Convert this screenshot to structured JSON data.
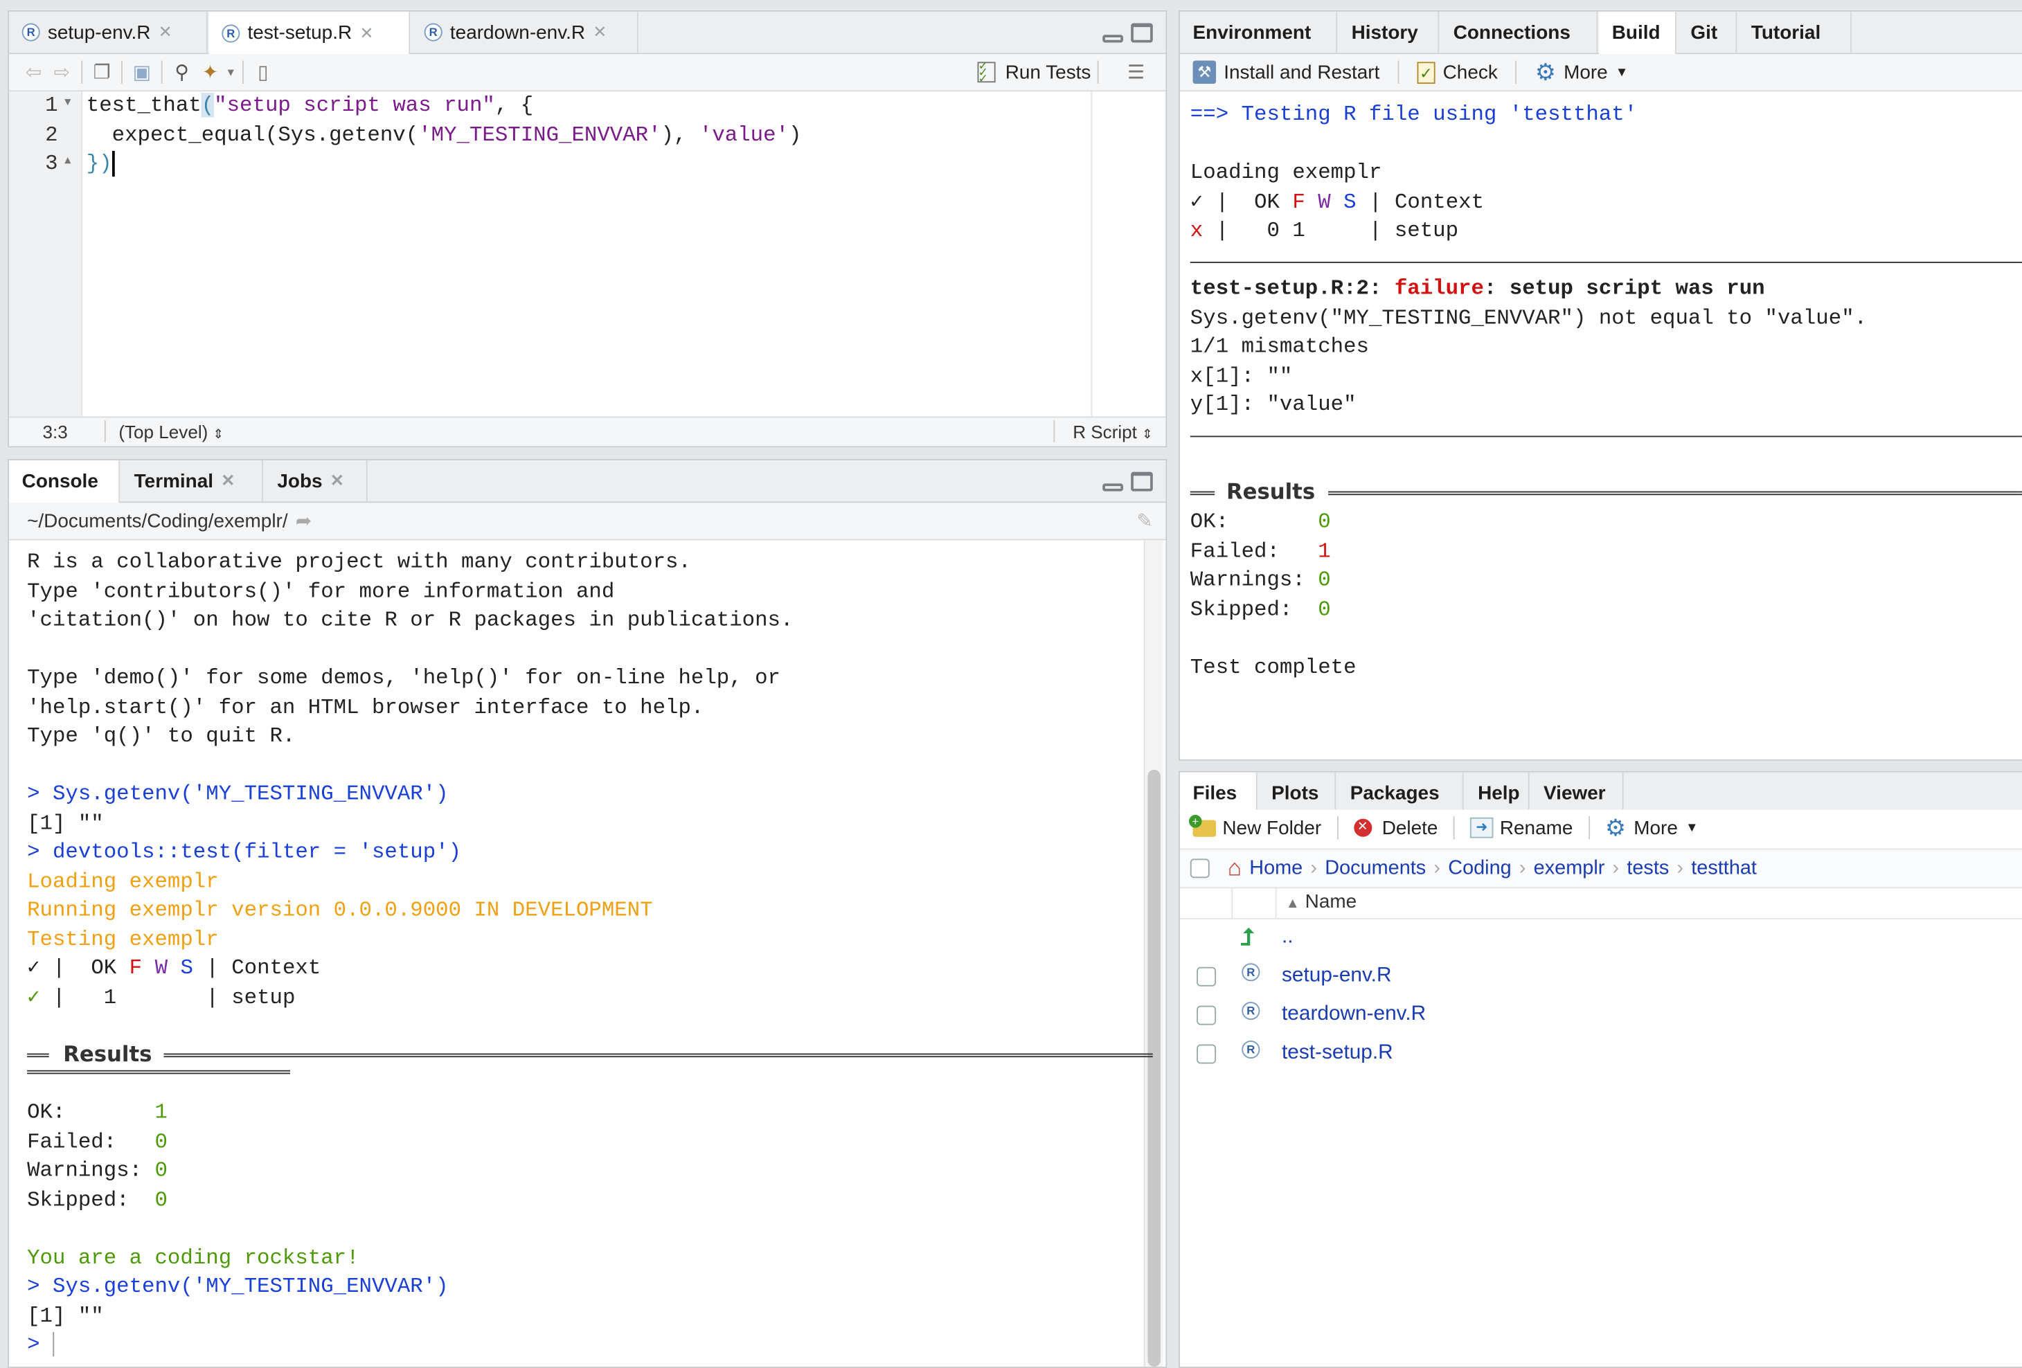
{
  "editor": {
    "tabs": [
      {
        "label": "setup-env.R"
      },
      {
        "label": "test-setup.R"
      },
      {
        "label": "teardown-env.R"
      }
    ],
    "run_tests": "Run Tests",
    "line_numbers": [
      "1",
      "2",
      "3"
    ],
    "code": {
      "l1_fn": "test_that",
      "l1_paren": "(",
      "l1_str": "\"setup script was run\"",
      "l1_rest": ", {",
      "l2_fn": "  expect_equal(Sys.getenv(",
      "l2_str1": "'MY_TESTING_ENVVAR'",
      "l2_mid": "), ",
      "l2_str2": "'value'",
      "l2_end": ")",
      "l3": "})"
    },
    "status": {
      "position": "3:3",
      "scope": "(Top Level)",
      "filetype": "R Script"
    }
  },
  "console": {
    "tabs": [
      "Console",
      "Terminal",
      "Jobs"
    ],
    "path": "~/Documents/Coding/exemplr/",
    "lines": {
      "l1": "R is a collaborative project with many contributors.",
      "l2": "Type 'contributors()' for more information and",
      "l3": "'citation()' on how to cite R or R packages in publications.",
      "l4": "Type 'demo()' for some demos, 'help()' for on-line help, or",
      "l5": "'help.start()' for an HTML browser interface to help.",
      "l6": "Type 'q()' to quit R.",
      "cmd1": "> Sys.getenv('MY_TESTING_ENVVAR')",
      "out1": "[1] \"\"",
      "cmd2": "> devtools::test(filter = 'setup')",
      "load": "Loading exemplr",
      "running": "Running exemplr version 0.0.0.9000 IN DEVELOPMENT",
      "testing": "Testing exemplr",
      "hdr_check": "✓ |  OK ",
      "hdr_f": "F",
      "hdr_w": "W",
      "hdr_s": "S",
      "hdr_ctx": " | Context",
      "row_check": "✓",
      "row_rest": " |   1       | setup",
      "results": "Results",
      "ok_label": "OK:       ",
      "ok_val": "1",
      "failed_label": "Failed:   ",
      "failed_val": "0",
      "warn_label": "Warnings: ",
      "warn_val": "0",
      "skip_label": "Skipped:  ",
      "skip_val": "0",
      "rockstar": "You are a coding rockstar!",
      "cmd3": "> Sys.getenv('MY_TESTING_ENVVAR')",
      "out3": "[1] \"\"",
      "prompt": ">"
    }
  },
  "build": {
    "tabs": [
      "Environment",
      "History",
      "Connections",
      "Build",
      "Git",
      "Tutorial"
    ],
    "toolbar": {
      "install": "Install and Restart",
      "check": "Check",
      "more": "More"
    },
    "lines": {
      "header": "==> Testing R file using 'testthat'",
      "load": "Loading exemplr",
      "hdr_check": "✓ |  OK ",
      "hdr_f": "F",
      "hdr_w": "W",
      "hdr_s": "S",
      "hdr_ctx": " | Context",
      "row_x": "x",
      "row_rest": " |   0 1     | setup",
      "fail_file": "test-setup.R:2: ",
      "fail_word": "failure",
      "fail_msg": ": setup script was run",
      "msg1": "Sys.getenv(\"MY_TESTING_ENVVAR\") not equal to \"value\".",
      "msg2": "1/1 mismatches",
      "msg3": "x[1]: \"\"",
      "msg4": "y[1]: \"value\"",
      "results": "Results",
      "ok_label": "OK:       ",
      "ok_val": "0",
      "failed_label": "Failed:   ",
      "failed_val": "1",
      "warn_label": "Warnings: ",
      "warn_val": "0",
      "skip_label": "Skipped:  ",
      "skip_val": "0",
      "complete": "Test complete"
    }
  },
  "files": {
    "tabs": [
      "Files",
      "Plots",
      "Packages",
      "Help",
      "Viewer"
    ],
    "toolbar": {
      "new_folder": "New Folder",
      "delete": "Delete",
      "rename": "Rename",
      "more": "More"
    },
    "breadcrumb": [
      "Home",
      "Documents",
      "Coding",
      "exemplr",
      "tests",
      "testthat"
    ],
    "column_name": "Name",
    "parent": "..",
    "items": [
      "setup-env.R",
      "teardown-env.R",
      "test-setup.R"
    ]
  }
}
